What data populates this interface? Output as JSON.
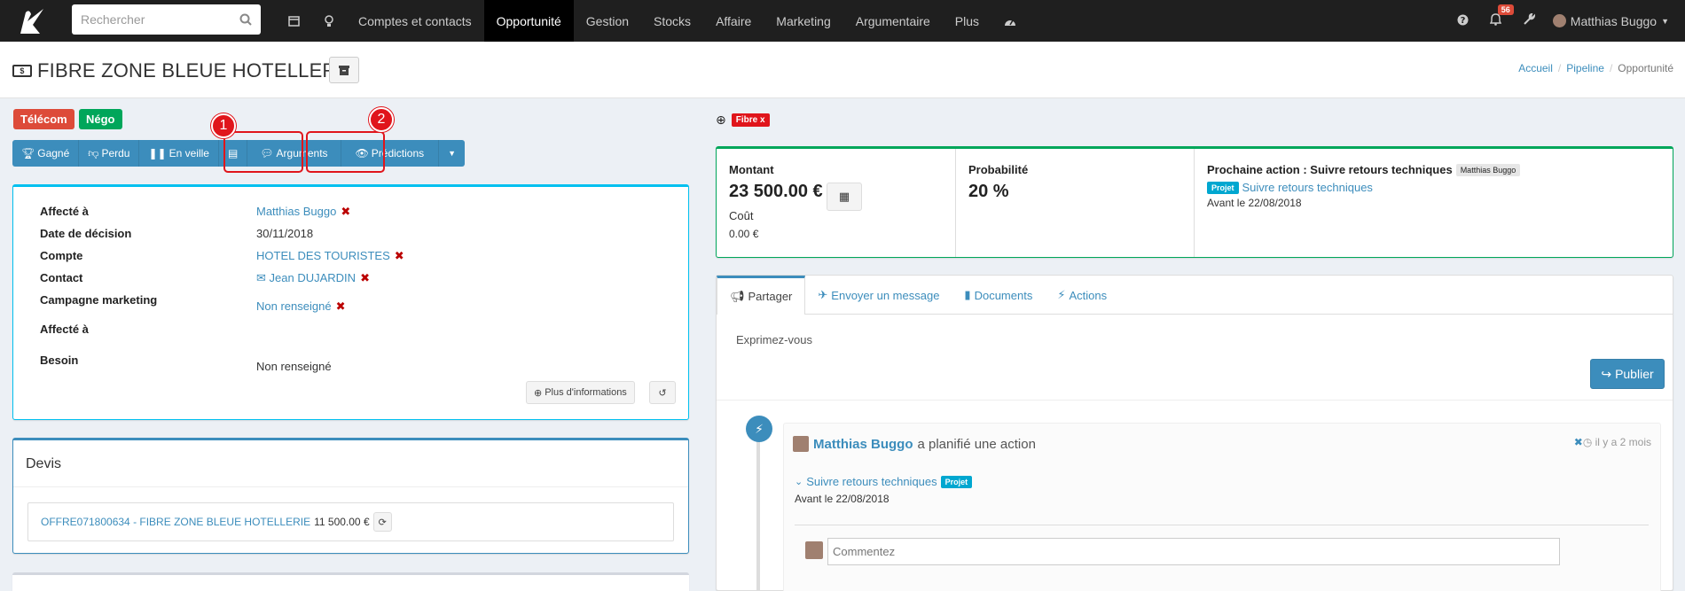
{
  "nav": {
    "search_placeholder": "Rechercher",
    "items": [
      "Comptes et contacts",
      "Opportunité",
      "Gestion",
      "Stocks",
      "Affaire",
      "Marketing",
      "Argumentaire",
      "Plus"
    ],
    "active": "Opportunité",
    "notif_count": "56",
    "user_name": "Matthias Buggo"
  },
  "header": {
    "title": "FIBRE ZONE BLEUE HOTELLERIE",
    "breadcrumb": [
      "Accueil",
      "Pipeline",
      "Opportunité"
    ]
  },
  "tags": {
    "telecom": "Télécom",
    "nego": "Négo"
  },
  "actions": {
    "gagne": "Gagné",
    "perdu": "Perdu",
    "veille": "En veille",
    "arguments": "Arguments",
    "predictions": "Prédictions"
  },
  "annotations": {
    "one": "1",
    "two": "2"
  },
  "details": {
    "affecte_label": "Affecté à",
    "affecte_value": "Matthias Buggo",
    "date_label": "Date de décision",
    "date_value": "30/11/2018",
    "compte_label": "Compte",
    "compte_value": "HOTEL DES TOURISTES",
    "contact_label": "Contact",
    "contact_value": "Jean DUJARDIN",
    "campagne_label": "Campagne marketing",
    "campagne_value": "Non renseigné",
    "affecte2_label": "Affecté à",
    "besoin_label": "Besoin",
    "besoin_value": "Non renseigné",
    "more_btn": "Plus d'informations"
  },
  "devis": {
    "title": "Devis",
    "link": "OFFRE071800634 - FIBRE ZONE BLEUE HOTELLERIE",
    "amount": "11 500.00 €"
  },
  "fibre": {
    "label": "Fibre x"
  },
  "stats": {
    "montant_label": "Montant",
    "montant_value": "23 500.00 €",
    "cout_label": "Coût",
    "cout_value": "0.00 €",
    "proba_label": "Probabilité",
    "proba_value": "20 %",
    "next_label": "Prochaine action : Suivre retours techniques",
    "next_user": "Matthias Buggo",
    "projet": "Projet",
    "next_link": "Suivre retours techniques",
    "next_date": "Avant le 22/08/2018"
  },
  "share": {
    "tabs": [
      "Partager",
      "Envoyer un message",
      "Documents",
      "Actions"
    ],
    "placeholder": "Exprimez-vous",
    "publish": "Publier"
  },
  "timeline": {
    "user": "Matthias Buggo",
    "action": "a planifié une action",
    "time": "il y a 2 mois",
    "link": "Suivre retours techniques",
    "projet": "Projet",
    "date": "Avant le 22/08/2018",
    "comment_placeholder": "Commentez"
  },
  "colors": {
    "primary": "#3c8dbc",
    "danger": "#dd4b39",
    "success": "#00a65a",
    "info": "#00c0ef",
    "annotation": "#e0151b"
  }
}
